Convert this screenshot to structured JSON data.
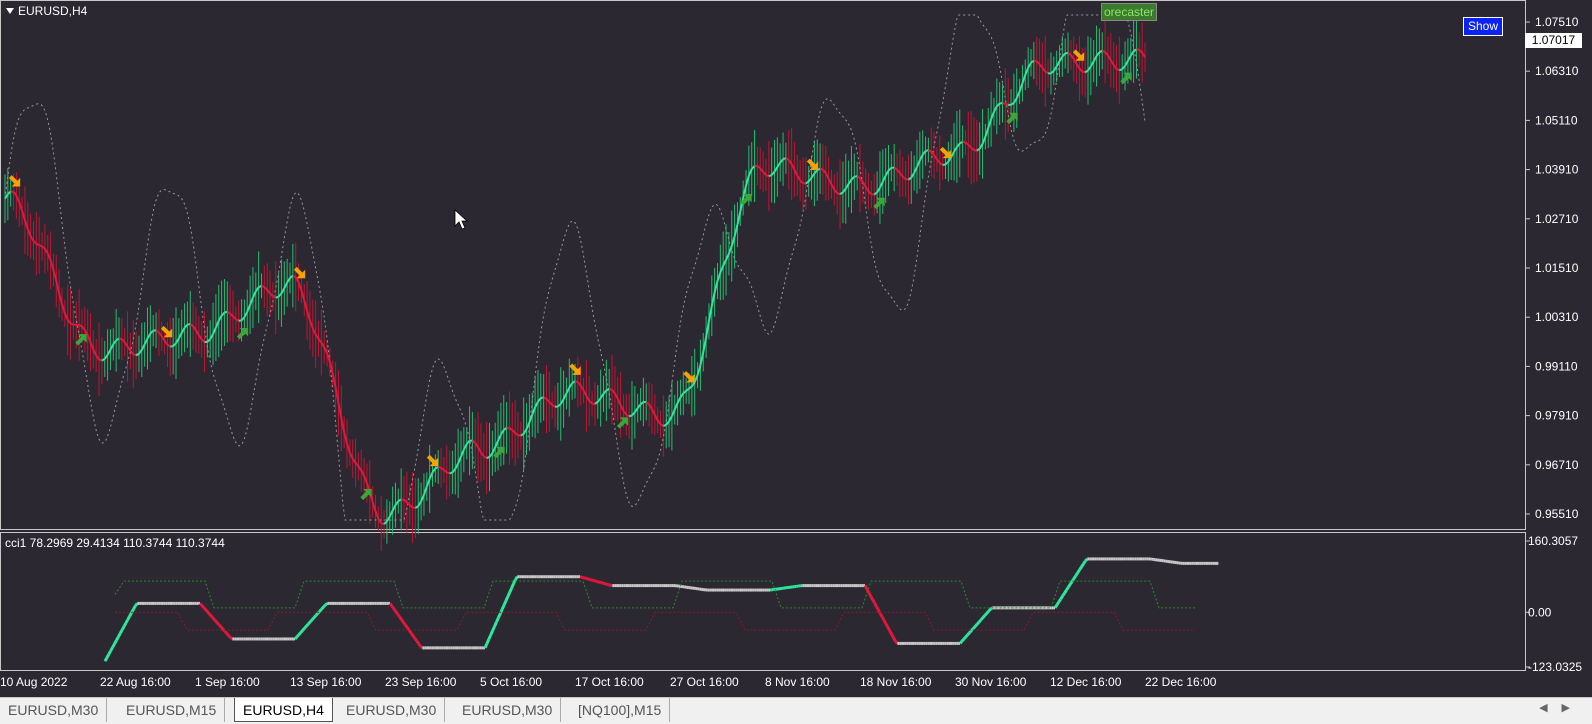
{
  "main_chart": {
    "symbol": "EURUSD,H4",
    "current_price": "1.07017",
    "price_axis_labels": [
      "1.07510",
      "1.06310",
      "1.05110",
      "1.03910",
      "1.02710",
      "1.01510",
      "1.00310",
      "0.99110",
      "0.97910",
      "0.96710",
      "0.95510"
    ],
    "show_button": "Show",
    "forecaster_label": "orecaster",
    "colors": {
      "background": "#2b2832",
      "up": "#2ee89c",
      "down": "#e3173c",
      "buy_arrow": "#3aa73a",
      "sell_arrow": "#f5a300"
    }
  },
  "subwindow": {
    "title": "cci1 78.2969 29.4134 110.3744 110.3744",
    "axis_labels": [
      "160.3057",
      "0.00",
      "-123.0325"
    ]
  },
  "time_axis_labels": [
    "10 Aug 2022",
    "22 Aug 16:00",
    "1 Sep 16:00",
    "13 Sep 16:00",
    "23 Sep 16:00",
    "5 Oct 16:00",
    "17 Oct 16:00",
    "27 Oct 16:00",
    "8 Nov 16:00",
    "18 Nov 16:00",
    "30 Nov 16:00",
    "12 Dec 16:00",
    "22 Dec 16:00"
  ],
  "tabs": [
    {
      "label": "EURUSD,M30",
      "active": false
    },
    {
      "label": "EURUSD,M15",
      "active": false
    },
    {
      "label": "EURUSD,H4",
      "active": true
    },
    {
      "label": "EURUSD,M30",
      "active": false
    },
    {
      "label": "EURUSD,M30",
      "active": false
    },
    {
      "label": "[NQ100],M15",
      "active": false
    }
  ],
  "chart_data": {
    "type": "line",
    "title": "EURUSD,H4",
    "ylim": [
      0.9511,
      1.0751
    ],
    "x": [
      "10 Aug 2022",
      "22 Aug 16:00",
      "1 Sep 16:00",
      "13 Sep 16:00",
      "23 Sep 16:00",
      "5 Oct 16:00",
      "17 Oct 16:00",
      "27 Oct 16:00",
      "8 Nov 16:00",
      "18 Nov 16:00",
      "30 Nov 16:00",
      "12 Dec 16:00",
      "22 Dec 16:00"
    ],
    "series": [
      {
        "values": [
          1.032,
          0.995,
          0.999,
          1.011,
          0.955,
          0.971,
          0.985,
          0.979,
          1.04,
          1.035,
          1.043,
          1.065,
          1.066
        ]
      }
    ],
    "cci": {
      "ylim": [
        -123.0325,
        160.3057
      ],
      "values": [
        -110,
        20,
        -60,
        20,
        -80,
        80,
        60,
        50,
        60,
        -70,
        10,
        120,
        110
      ]
    }
  }
}
